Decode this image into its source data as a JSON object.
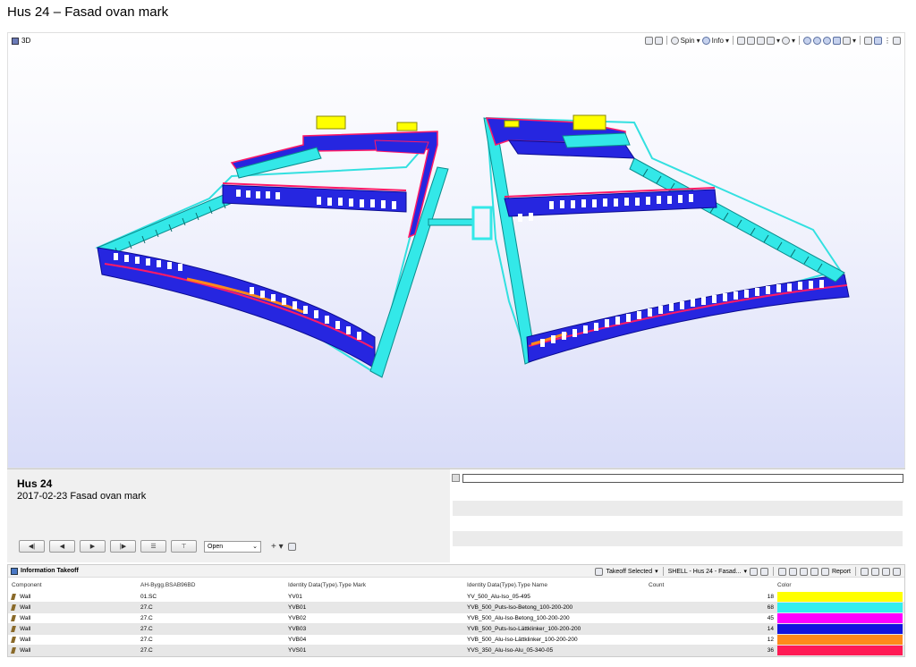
{
  "doc_title": "Hus 24 – Fasad ovan mark",
  "viewport": {
    "label": "3D",
    "toolbar": {
      "spin_label": "Spin",
      "info_label": "Info"
    }
  },
  "info": {
    "name": "Hus 24",
    "description": "2017-02-23 Fasad ovan mark",
    "select_value": "Open"
  },
  "takeoff": {
    "title": "Information Takeoff",
    "selected_label": "Takeoff Selected",
    "shell_label": "SHELL - Hus 24 - Fasad...",
    "report_label": "Report",
    "columns": [
      "Component",
      "AH-Bygg.BSAB96BD",
      "Identity Data(Type).Type Mark",
      "Identity Data(Type).Type Name",
      "Count",
      "Color"
    ],
    "rows": [
      {
        "component": "Wall",
        "bsab": "01.SC",
        "mark": "YV01",
        "name": "YV_500_Alu-Iso_05-495",
        "count": "18",
        "color": "#ffff00"
      },
      {
        "component": "Wall",
        "bsab": "27.C",
        "mark": "YVB01",
        "name": "YVB_500_Puts-Iso-Betong_100-200-200",
        "count": "68",
        "color": "#33eeee"
      },
      {
        "component": "Wall",
        "bsab": "27.C",
        "mark": "YVB02",
        "name": "YVB_500_Alu-Iso-Betong_100-200-200",
        "count": "45",
        "color": "#ff00ff"
      },
      {
        "component": "Wall",
        "bsab": "27.C",
        "mark": "YVB03",
        "name": "YVB_500_Puts-Iso-Lättklinker_100-200-200",
        "count": "14",
        "color": "#1414dd"
      },
      {
        "component": "Wall",
        "bsab": "27.C",
        "mark": "YVB04",
        "name": "YVB_500_Alu-Iso-Lättklinker_100-200-200",
        "count": "12",
        "color": "#ff8a1a"
      },
      {
        "component": "Wall",
        "bsab": "27.C",
        "mark": "YVS01",
        "name": "YVS_350_Alu-Iso-Alu_05-340-05",
        "count": "36",
        "color": "#ff1a55"
      }
    ]
  }
}
